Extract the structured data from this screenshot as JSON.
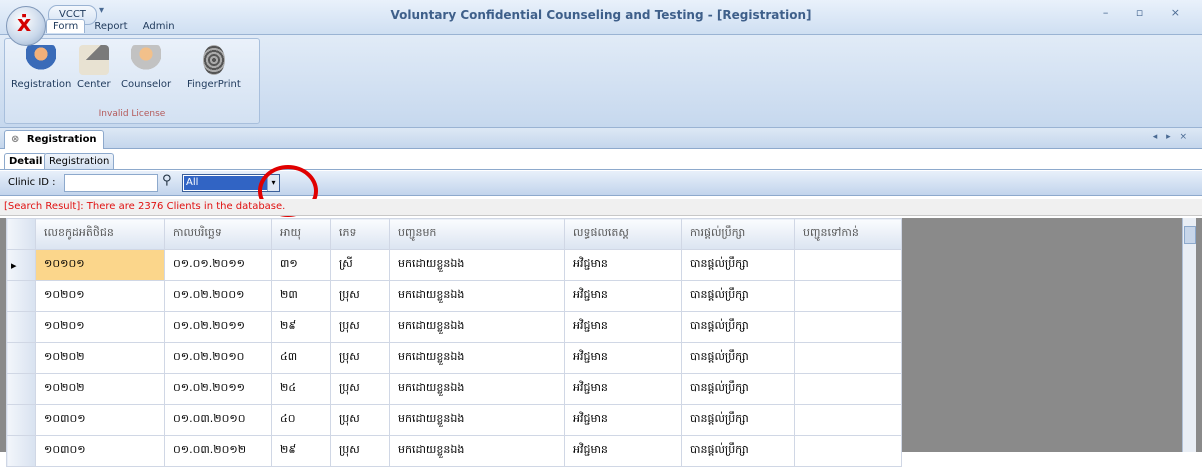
{
  "app": {
    "quick_access": "VCCT",
    "title": "Voluntary Confidential Counseling and Testing - [Registration]",
    "window_buttons": "– ▫ ×",
    "tabs": [
      "Form",
      "Report",
      "Admin"
    ]
  },
  "ribbon": {
    "buttons": [
      "Registration",
      "Center",
      "Counselor",
      "FingerPrint"
    ],
    "group_label": "Invalid License"
  },
  "document": {
    "tab_label": "Registration",
    "sub_tabs": [
      "Detail",
      "Registration"
    ]
  },
  "toolbar": {
    "clinic_label": "Clinic ID :",
    "clinic_value": "",
    "filter_value": "All"
  },
  "status_text": "[Search Result]: There are 2376 Clients in the database.",
  "grid": {
    "columns": [
      "លេខកូដអតិថិជន",
      "កាលបរិច្ឆេទ",
      "អាយុ",
      "ភេទ",
      "បញ្ជូនមក",
      "លទ្ធផលតេស្ត",
      "ការផ្តល់ប្រឹក្សា",
      "បញ្ជូនទៅកាន់"
    ],
    "rows": [
      [
        "១០១០១",
        "០១.០១.២០១១",
        "៣១",
        "ស្រី",
        "មកដោយខ្លួនឯង",
        "អវិជ្ជមាន",
        "បានផ្តល់ប្រឹក្សា",
        ""
      ],
      [
        "១០២០១",
        "០១.០២.២០០១",
        "២៣",
        "ប្រុស",
        "មកដោយខ្លួនឯង",
        "អវិជ្ជមាន",
        "បានផ្តល់ប្រឹក្សា",
        ""
      ],
      [
        "១០២០១",
        "០១.០២.២០១១",
        "២៩",
        "ប្រុស",
        "មកដោយខ្លួនឯង",
        "អវិជ្ជមាន",
        "បានផ្តល់ប្រឹក្សា",
        ""
      ],
      [
        "១០២០២",
        "០១.០២.២០១០",
        "៤៣",
        "ប្រុស",
        "មកដោយខ្លួនឯង",
        "អវិជ្ជមាន",
        "បានផ្តល់ប្រឹក្សា",
        ""
      ],
      [
        "១០២០២",
        "០១.០២.២០១១",
        "២៤",
        "ប្រុស",
        "មកដោយខ្លួនឯង",
        "អវិជ្ជមាន",
        "បានផ្តល់ប្រឹក្សា",
        ""
      ],
      [
        "១០៣០១",
        "០១.០៣.២០១០",
        "៤០",
        "ប្រុស",
        "មកដោយខ្លួនឯង",
        "អវិជ្ជមាន",
        "បានផ្តល់ប្រឹក្សា",
        ""
      ],
      [
        "១០៣០១",
        "០១.០៣.២០១២",
        "២៩",
        "ប្រុស",
        "មកដោយខ្លួនឯង",
        "អវិជ្ជមាន",
        "បានផ្តល់ប្រឹក្សា",
        ""
      ]
    ]
  },
  "colors": {
    "selected_cell": "#fbd68b",
    "status_text": "#e01010",
    "annotation": "#e00000"
  },
  "icons": [
    "registration-icon",
    "center-icon",
    "counselor-icon",
    "fingerprint-icon",
    "search-icon",
    "dropdown-arrow-icon"
  ]
}
